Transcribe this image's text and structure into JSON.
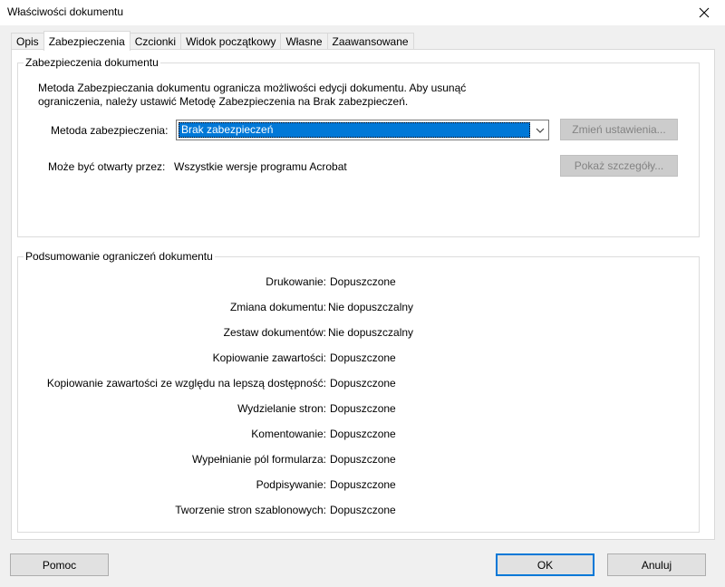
{
  "window": {
    "title": "Właściwości dokumentu",
    "close_icon": "close-icon"
  },
  "tabs": [
    {
      "label": "Opis",
      "active": false
    },
    {
      "label": "Zabezpieczenia",
      "active": true
    },
    {
      "label": "Czcionki",
      "active": false
    },
    {
      "label": "Widok początkowy",
      "active": false
    },
    {
      "label": "Własne",
      "active": false
    },
    {
      "label": "Zaawansowane",
      "active": false
    }
  ],
  "security": {
    "group_title": "Zabezpieczenia dokumentu",
    "description": "Metoda Zabezpieczania dokumentu ogranicza możliwości edycji dokumentu. Aby usunąć ograniczenia, należy ustawić Metodę Zabezpieczenia na Brak zabezpieczeń.",
    "method_label": "Metoda zabezpieczenia:",
    "method_value": "Brak zabezpieczeń",
    "change_settings_button": "Zmień ustawienia...",
    "opened_by_label": "Może być otwarty przez:",
    "opened_by_value": "Wszystkie wersje programu Acrobat",
    "show_details_button": "Pokaż szczegóły..."
  },
  "restrictions": {
    "group_title": "Podsumowanie ograniczeń dokumentu",
    "rows": [
      {
        "label": "Drukowanie:",
        "value": "Dopuszczone"
      },
      {
        "label": "Zmiana dokumentu:",
        "value": "Nie dopuszczalny"
      },
      {
        "label": "Zestaw dokumentów:",
        "value": "Nie dopuszczalny"
      },
      {
        "label": "Kopiowanie zawartości:",
        "value": "Dopuszczone"
      },
      {
        "label": "Kopiowanie zawartości ze względu na lepszą dostępność:",
        "value": "Dopuszczone"
      },
      {
        "label": "Wydzielanie stron:",
        "value": "Dopuszczone"
      },
      {
        "label": "Komentowanie:",
        "value": "Dopuszczone"
      },
      {
        "label": "Wypełnianie pól formularza:",
        "value": "Dopuszczone"
      },
      {
        "label": "Podpisywanie:",
        "value": "Dopuszczone"
      },
      {
        "label": "Tworzenie stron szablonowych:",
        "value": "Dopuszczone"
      }
    ]
  },
  "footer": {
    "help_button": "Pomoc",
    "ok_button": "OK",
    "cancel_button": "Anuluj"
  },
  "colors": {
    "selection": "#0078d7",
    "dialog_background": "#f0f0f0",
    "panel_background": "#ffffff",
    "disabled_text": "#838383"
  }
}
